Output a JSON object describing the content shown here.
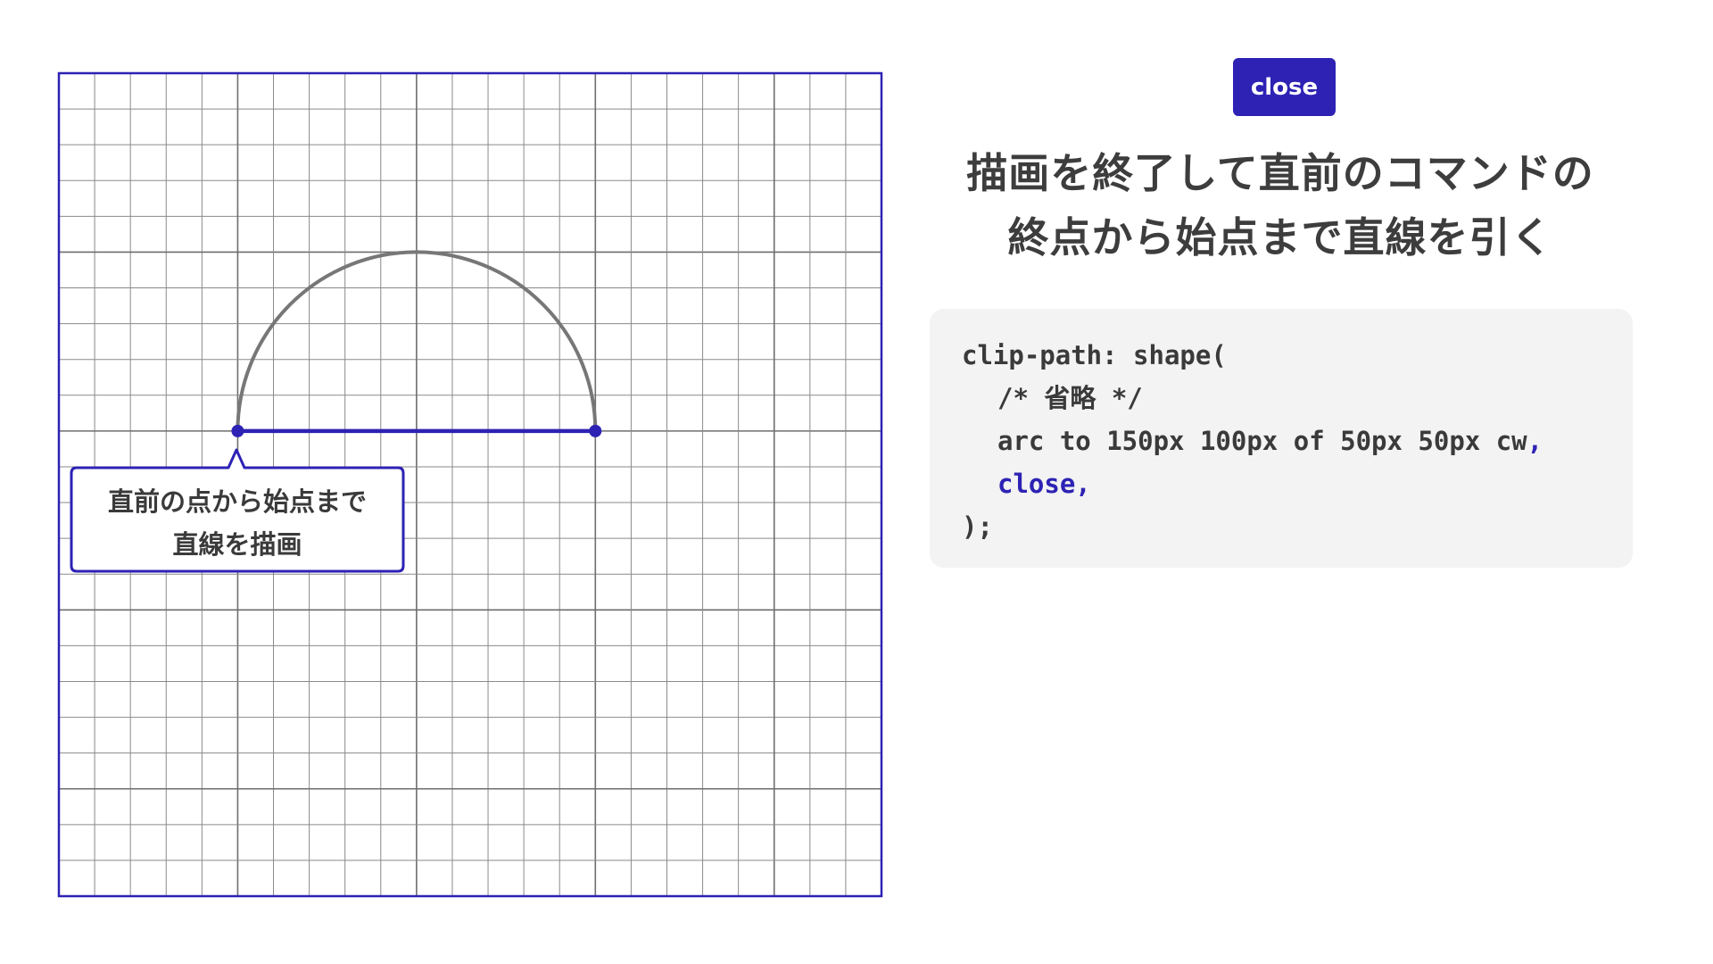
{
  "tag": {
    "label": "close"
  },
  "heading": {
    "lines": [
      "描画を終了して直前のコマンドの",
      "終点から始点まで直線を引く"
    ]
  },
  "code": {
    "line1": "clip-path: shape(",
    "line2": "/* 省略 */",
    "line3": "arc to 150px 100px of 50px 50px cw",
    "line3_comma": ",",
    "line4_keyword": "close,",
    "line5": ");"
  },
  "callout": {
    "lines": [
      "直前の点から始点まで",
      "直線を描画"
    ]
  },
  "colors": {
    "accent": "#2d22b4",
    "arc_stroke": "#777777",
    "grid_line": "#8a8a8a",
    "grid_major": "#6e6e6e",
    "code_background": "#f2f3f2",
    "heading_text": "#3d3d3d"
  },
  "diagram": {
    "grid_units": 230,
    "minor_step": 10,
    "major_step": 50,
    "arc_start": [
      50,
      100
    ],
    "arc_end": [
      150,
      100
    ],
    "arc_radius": [
      50,
      50
    ],
    "arc_direction": "cw"
  }
}
